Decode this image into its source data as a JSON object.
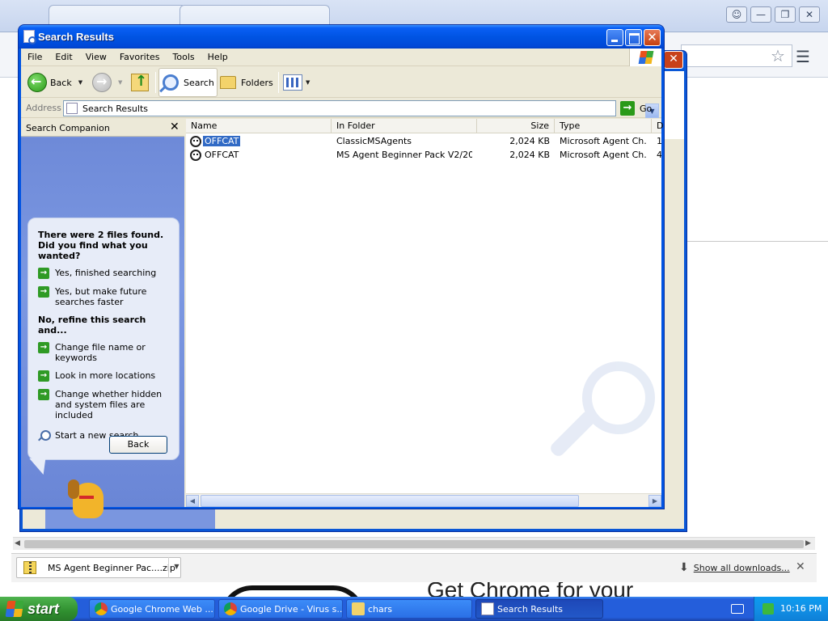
{
  "search_window": {
    "title": "Search Results",
    "menu": [
      "File",
      "Edit",
      "View",
      "Favorites",
      "Tools",
      "Help"
    ],
    "toolbar": {
      "back_label": "Back",
      "search_label": "Search",
      "folders_label": "Folders"
    },
    "address": {
      "label": "Address",
      "value": "Search Results",
      "go_label": "Go"
    },
    "companion": {
      "title": "Search Companion",
      "close_glyph": "✕",
      "found_message": "There were 2 files found. Did you find what you wanted?",
      "options_found": [
        "Yes, finished searching",
        "Yes, but make future searches faster"
      ],
      "refine_heading": "No, refine this search and...",
      "options_refine": [
        "Change file name or keywords",
        "Look in more locations",
        "Change whether hidden and system files are included"
      ],
      "new_search_label": "Start a new search",
      "back_button_label": "Back"
    },
    "results": {
      "columns": [
        "Name",
        "In Folder",
        "Size",
        "Type",
        "D"
      ],
      "rows": [
        {
          "name": "OFFCAT",
          "folder": "ClassicMSAgents",
          "size": "2,024 KB",
          "type": "Microsoft Agent Ch...",
          "date": "1",
          "selected": true
        },
        {
          "name": "OFFCAT",
          "folder": "MS Agent Beginner Pack V2/20 ...",
          "size": "2,024 KB",
          "type": "Microsoft Agent Ch...",
          "date": "4",
          "selected": false
        }
      ]
    }
  },
  "chrome": {
    "downloads": {
      "file_name": "MS Agent Beginner Pac....zip",
      "show_all_label": "Show all downloads...",
      "close_glyph": "✕"
    },
    "page_text": "Get Chrome for your"
  },
  "taskbar": {
    "start_label": "start",
    "tasks": [
      "Google Chrome Web ...",
      "Google Drive - Virus s...",
      "chars",
      "Search Results"
    ],
    "clock": "10:16 PM"
  },
  "colors": {
    "xp_blue": "#0054e3",
    "taskbar_blue": "#245edb",
    "start_green": "#2f8f2f",
    "selection_blue": "#316ac5",
    "companion_blue": "#7a96df"
  }
}
